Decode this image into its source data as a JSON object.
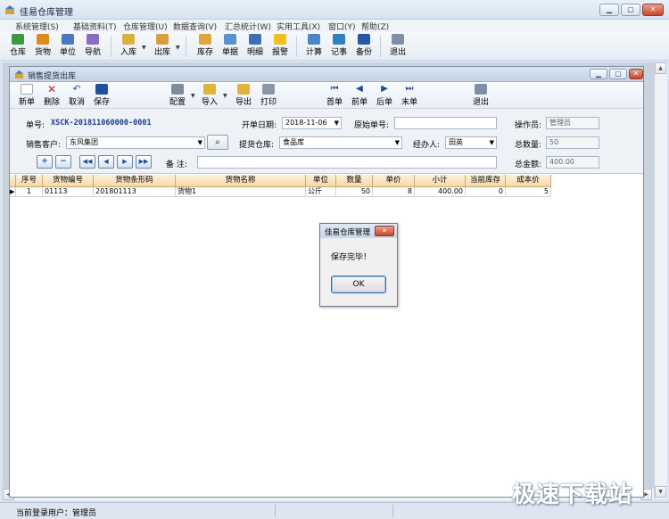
{
  "window": {
    "title": "佳易仓库管理"
  },
  "menu": [
    "系统管理(S)",
    "基础资料(T)",
    "仓库管理(U)",
    "数据查询(V)",
    "汇总统计(W)",
    "实用工具(X)",
    "窗口(Y)",
    "帮助(Z)"
  ],
  "toolbar": [
    "仓库",
    "货物",
    "单位",
    "导航",
    "入库",
    "出库",
    "库存",
    "单据",
    "明细",
    "报警",
    "计算",
    "记事",
    "备份",
    "退出"
  ],
  "child": {
    "title": "销售提货出库",
    "toolbar": [
      "新单",
      "删除",
      "取消",
      "保存",
      "配置",
      "导入",
      "导出",
      "打印",
      "首单",
      "前单",
      "后单",
      "末单",
      "退出"
    ]
  },
  "form": {
    "doc_no_label": "单号:",
    "doc_no": "XSCK-201811060000-0001",
    "open_date_label": "开单日期:",
    "open_date": "2018-11-06",
    "orig_no_label": "原始单号:",
    "orig_no": "",
    "operator_label": "操作员:",
    "operator": "管理员",
    "customer_label": "销售客户:",
    "customer": "东风集团",
    "warehouse_label": "提货仓库:",
    "warehouse": "食品库",
    "handler_label": "经办人:",
    "handler": "田英",
    "total_qty_label": "总数量:",
    "total_qty": "50",
    "remark_label": "备 注:",
    "remark": "",
    "total_amount_label": "总金额:",
    "total_amount": "400.00"
  },
  "grid": {
    "headers": [
      "序号",
      "货物编号",
      "货物条形码",
      "货物名称",
      "单位",
      "数量",
      "单价",
      "小计",
      "当前库存",
      "成本价"
    ],
    "rows": [
      [
        "1",
        "01113",
        "201801113",
        "货物1",
        "公斤",
        "50",
        "8",
        "400.00",
        "0",
        "5"
      ]
    ]
  },
  "dialog": {
    "title": "佳易仓库管理",
    "message": "保存完毕！",
    "ok": "OK"
  },
  "status": {
    "text": "当前登录用户：管理员"
  },
  "watermark": "极速下载站",
  "colors": {
    "nav_blue": "#1c4f9c",
    "grid_header": "#f5d9a8",
    "doc_no_blue": "#1a3a8f"
  }
}
